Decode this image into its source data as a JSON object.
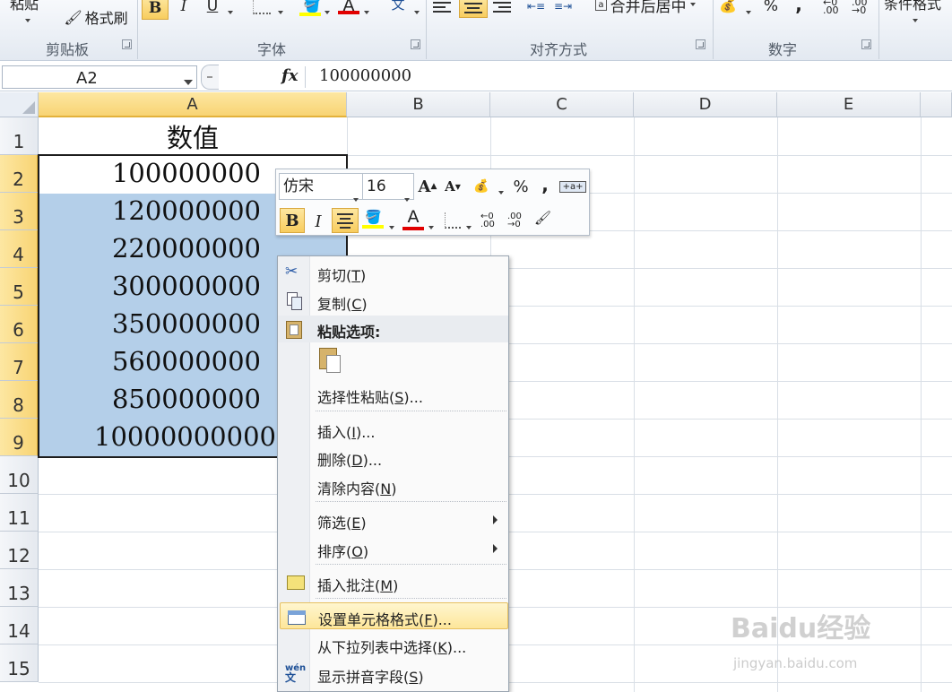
{
  "ribbon": {
    "groups": [
      {
        "label": "剪贴板"
      },
      {
        "label": "字体"
      },
      {
        "label": "对齐方式"
      },
      {
        "label": "数字"
      }
    ],
    "paste_label": "粘贴",
    "format_painter_label": "格式刷",
    "bold_label": "B",
    "italic_label": "I",
    "underline_label": "U",
    "font_color_label": "A",
    "merge_center_label": "合并后居中",
    "percent_label": "%",
    "comma_label": ",",
    "conditional_label": "条件格式"
  },
  "formula_bar": {
    "name_box": "A2",
    "fx_label": "fx",
    "formula": "100000000"
  },
  "columns": [
    "A",
    "B",
    "C",
    "D",
    "E"
  ],
  "rows": [
    "1",
    "2",
    "3",
    "4",
    "5",
    "6",
    "7",
    "8",
    "9",
    "10",
    "11",
    "12",
    "13",
    "14",
    "15"
  ],
  "cells": {
    "A1": "数值",
    "A2": "100000000",
    "A3": "120000000",
    "A4": "220000000",
    "A5": "300000000",
    "A6": "350000000",
    "A7": "560000000",
    "A8": "850000000",
    "A9": "10000000000"
  },
  "mini_toolbar": {
    "font_name": "仿宋",
    "font_size": "16",
    "bold_label": "B",
    "italic_label": "I",
    "font_color_label": "A",
    "percent_label": "%",
    "comma_label": ","
  },
  "context_menu": {
    "cut": {
      "text": "剪切(",
      "key": "T",
      "end": ")"
    },
    "copy": {
      "text": "复制(",
      "key": "C",
      "end": ")"
    },
    "paste_options": "粘贴选项:",
    "paste_special": {
      "text": "选择性粘贴(",
      "key": "S",
      "end": ")..."
    },
    "insert": {
      "text": "插入(",
      "key": "I",
      "end": ")..."
    },
    "delete": {
      "text": "删除(",
      "key": "D",
      "end": ")..."
    },
    "clear_contents": {
      "text": "清除内容(",
      "key": "N",
      "end": ")"
    },
    "filter": {
      "text": "筛选(",
      "key": "E",
      "end": ")"
    },
    "sort": {
      "text": "排序(",
      "key": "O",
      "end": ")"
    },
    "insert_comment": {
      "text": "插入批注(",
      "key": "M",
      "end": ")"
    },
    "format_cells": {
      "text": "设置单元格格式(",
      "key": "F",
      "end": ")..."
    },
    "pick_from_list": {
      "text": "从下拉列表中选择(",
      "key": "K",
      "end": ")..."
    },
    "phonetic": {
      "text": "显示拼音字段(",
      "key": "S",
      "end": ")"
    }
  },
  "watermark": {
    "brand": "Baidu经验",
    "url": "jingyan.baidu.com"
  },
  "colors": {
    "selection": "#b4cfe9",
    "header_selected": "#f8d474",
    "highlight": "#fde69a"
  }
}
